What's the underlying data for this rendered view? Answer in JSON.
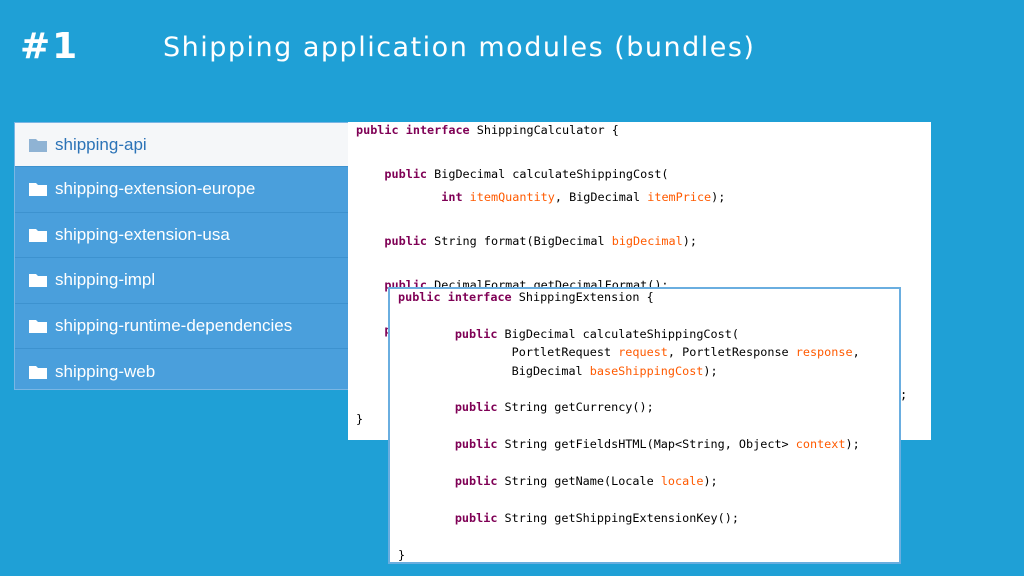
{
  "slide": {
    "number": "#1",
    "title": "Shipping application modules (bundles)"
  },
  "modules": {
    "items": [
      {
        "label": "shipping-api",
        "selected": true
      },
      {
        "label": "shipping-extension-europe",
        "selected": false
      },
      {
        "label": "shipping-extension-usa",
        "selected": false
      },
      {
        "label": "shipping-impl",
        "selected": false
      },
      {
        "label": "shipping-runtime-dependencies",
        "selected": false
      },
      {
        "label": "shipping-web",
        "selected": false
      }
    ],
    "icon": "folder-icon"
  },
  "code_back": {
    "lines": [
      "public interface ShippingCalculator {",
      "",
      "    public BigDecimal calculateShippingCost(",
      "            int itemQuantity, BigDecimal itemPrice);",
      "",
      "    public String format(BigDecimal bigDecimal);",
      "",
      "    public DecimalFormat getDecimalFormat();",
      "",
      "    public String getHoldingInstruction(Locale locale);",
      "",
      "",
      "",
      "}"
    ],
    "visible_tail": ";"
  },
  "code_front": {
    "lines": [
      "public interface ShippingExtension {",
      "",
      "        public BigDecimal calculateShippingCost(",
      "                PortletRequest request, PortletResponse response,",
      "                BigDecimal baseShippingCost);",
      "",
      "        public String getCurrency();",
      "",
      "        public String getFieldsHTML(Map<String, Object> context);",
      "",
      "        public String getName(Locale locale);",
      "",
      "        public String getShippingExtensionKey();",
      "",
      "}"
    ]
  },
  "colors": {
    "background": "#1fa0d6",
    "keyword": "#7f0055",
    "parameter": "#ff5a00",
    "list_fill": "#4a9fdc"
  }
}
